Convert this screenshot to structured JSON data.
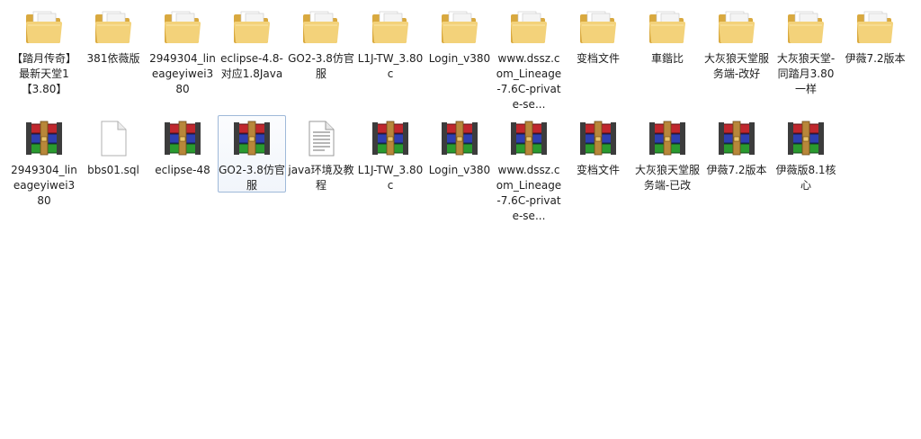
{
  "items_row1": [
    {
      "type": "folder",
      "label": "【踏月传奇】最新天堂1 【3.80】"
    },
    {
      "type": "folder",
      "label": "381依薇版"
    },
    {
      "type": "folder",
      "label": "2949304_lineageyiwei380"
    },
    {
      "type": "folder",
      "label": "eclipse-4.8-对应1.8Java"
    },
    {
      "type": "folder",
      "label": "GO2-3.8仿官服"
    },
    {
      "type": "folder",
      "label": "L1J-TW_3.80c"
    },
    {
      "type": "folder",
      "label": "Login_v380"
    },
    {
      "type": "folder",
      "label": "www.dssz.com_Lineage-7.6C-private-se..."
    },
    {
      "type": "folder",
      "label": "变档文件"
    },
    {
      "type": "folder",
      "label": "車鍇比"
    },
    {
      "type": "folder",
      "label": "大灰狼天堂服务端-改好"
    },
    {
      "type": "folder",
      "label": "大灰狼天堂-同踏月3.80一样"
    },
    {
      "type": "folder",
      "label": "伊薇7.2版本"
    }
  ],
  "items_row2": [
    {
      "type": "archive",
      "label": "2949304_lineageyiwei380"
    },
    {
      "type": "file",
      "label": "bbs01.sql"
    },
    {
      "type": "archive",
      "label": "eclipse-48"
    },
    {
      "type": "archive",
      "label": "GO2-3.8仿官服"
    },
    {
      "type": "text-doc",
      "label": "java环境及教程"
    },
    {
      "type": "archive",
      "label": "L1J-TW_3.80c"
    },
    {
      "type": "archive",
      "label": "Login_v380"
    },
    {
      "type": "archive",
      "label": "www.dssz.com_Lineage-7.6C-private-se..."
    },
    {
      "type": "archive",
      "label": "变档文件"
    },
    {
      "type": "archive",
      "label": "大灰狼天堂服务端-已改"
    },
    {
      "type": "archive",
      "label": "伊薇7.2版本"
    },
    {
      "type": "archive",
      "label": "伊薇版8.1核心"
    }
  ],
  "selected": {
    "row": 2,
    "index": 3
  },
  "colors": {
    "folder": "#f3d27a",
    "selection_border": "#9fb9d9",
    "rar_red": "#c0272d",
    "rar_blue": "#2f3fb0",
    "rar_green": "#2a9a2f"
  }
}
